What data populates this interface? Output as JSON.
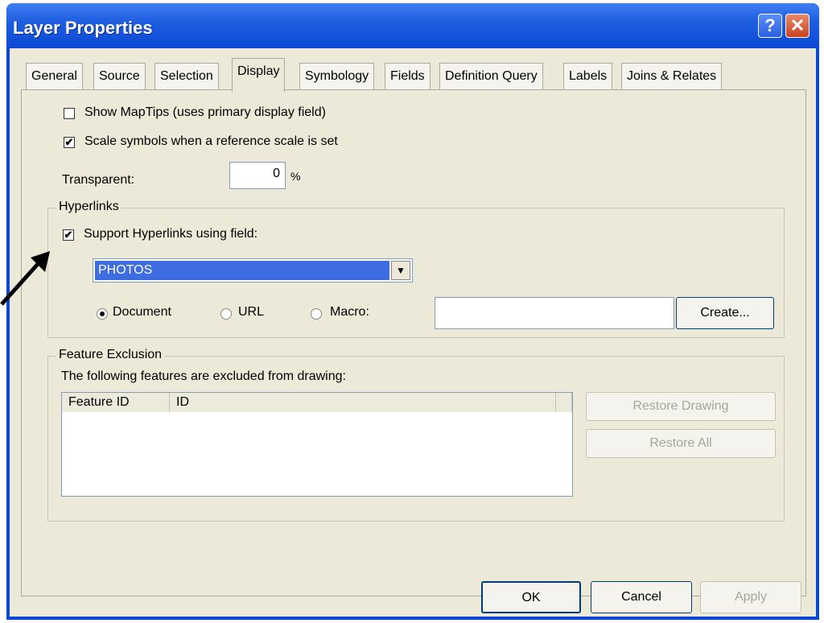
{
  "window": {
    "title": "Layer Properties",
    "help_glyph": "?",
    "close_glyph": "✕"
  },
  "tabs": [
    {
      "label": "General"
    },
    {
      "label": "Source"
    },
    {
      "label": "Selection"
    },
    {
      "label": "Display",
      "active": true
    },
    {
      "label": "Symbology"
    },
    {
      "label": "Fields"
    },
    {
      "label": "Definition Query"
    },
    {
      "label": "Labels"
    },
    {
      "label": "Joins & Relates"
    }
  ],
  "display": {
    "show_maptips": {
      "label": "Show MapTips (uses primary display field)",
      "checked": false
    },
    "scale_symbols": {
      "label": "Scale symbols when a reference scale is set",
      "checked": true
    },
    "transparent": {
      "label": "Transparent:",
      "value": "0",
      "unit": "%"
    }
  },
  "hyperlinks": {
    "group_title": "Hyperlinks",
    "support": {
      "label": "Support Hyperlinks using field:",
      "checked": true
    },
    "field_value": "PHOTOS",
    "radio_document": "Document",
    "radio_url": "URL",
    "radio_macro": "Macro:",
    "selected_radio": "Document",
    "macro_value": "",
    "create_button": "Create..."
  },
  "feature_exclusion": {
    "group_title": "Feature Exclusion",
    "description": "The following features are excluded from drawing:",
    "columns": [
      "Feature ID",
      "ID"
    ],
    "rows": [],
    "restore_drawing": "Restore Drawing",
    "restore_all": "Restore All"
  },
  "footer": {
    "ok": "OK",
    "cancel": "Cancel",
    "apply": "Apply"
  },
  "check_glyph": "✔"
}
